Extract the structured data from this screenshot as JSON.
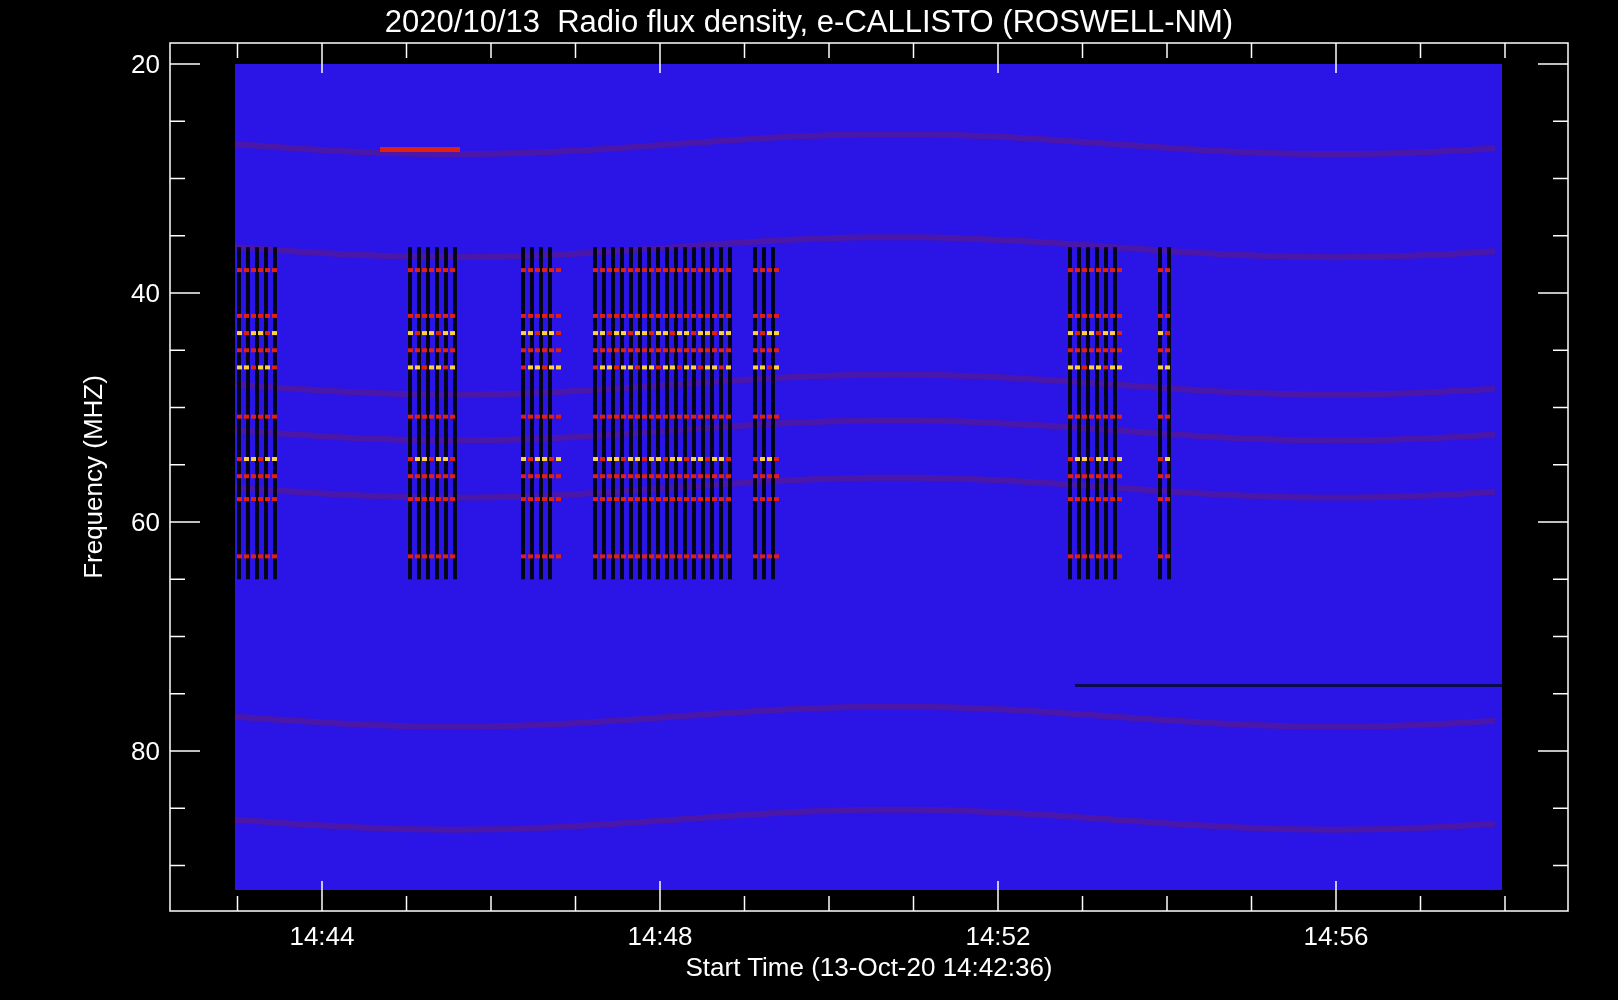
{
  "title": "2020/10/13  Radio flux density, e-CALLISTO (ROSWELL-NM)",
  "y_axis": {
    "label": "Frequency (MHZ)",
    "tick_labels": [
      "20",
      "40",
      "60",
      "80"
    ]
  },
  "x_axis": {
    "label": "Start Time (13-Oct-20 14:42:36)",
    "tick_labels": [
      "14:44",
      "14:48",
      "14:52",
      "14:56"
    ]
  }
}
